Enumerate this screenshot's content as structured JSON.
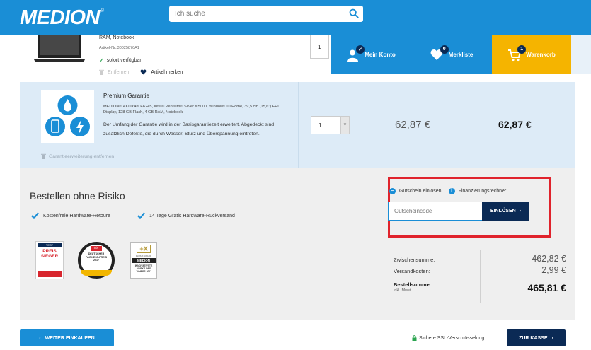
{
  "header": {
    "logo_text": "MEDION",
    "logo_reg": "®",
    "search_placeholder": "Ich suche"
  },
  "account": {
    "mein_konto": "Mein Konto",
    "merkliste": "Merkliste",
    "merkliste_count": "0",
    "warenkorb": "Warenkorb",
    "warenkorb_count": "1"
  },
  "product": {
    "subtitle": "RAM, Notebook",
    "article_no": "Artikel-Nr.:30025870A1",
    "availability": "sofort verfügbar",
    "remove_label": "Entfernen",
    "save_label": "Artikel merken",
    "quantity": "1"
  },
  "guarantee": {
    "title": "Premium Garantie",
    "description": "MEDION® AKOYA® E6245, Intel® Pentium® Silver N5000, Windows 10 Home, 39,5 cm (15,6\") FHD Display, 128 GB Flash, 4 GB RAM, Notebook",
    "details": "Der Umfang der Garantie wird in der Basisgarantiezeit erweitert. Abgedeckt sind zusätzlich Defekte, die durch Wasser, Sturz und Überspannung eintreten.",
    "remove_label": "Garantieerweiterung entfernen",
    "quantity": "1",
    "price": "62,87  €",
    "total": "62,87  €"
  },
  "risk": {
    "title": "Bestellen ohne Risiko",
    "feature1": "Kostenfreie Hardware-Retoure",
    "feature2": "14 Tage Gratis Hardware-Rückversand",
    "seal1_text": "PREIS SIEGER",
    "seal1_top": "TEST",
    "seal2_text": "DEUTSCHER FAIRNESS-PREIS 2017",
    "seal2_top": "ntv",
    "seal3_brand": "MEDION",
    "seal3_text": "INNOVATIVSTE MARKE DES JAHRES 2017",
    "seal3_top": "PLUS X AWARD"
  },
  "voucher": {
    "option1": "Gutschein einlösen",
    "option2": "Finanzierungsrechner",
    "placeholder": "Gutscheincode",
    "button": "EINLÖSEN",
    "colors": {
      "highlight": "#e0232c",
      "navy": "#0b2a55"
    }
  },
  "summary": {
    "zwischensumme_label": "Zwischensumme:",
    "zwischensumme_value": "462,82  €",
    "versand_label": "Versandkosten:",
    "versand_value": "2,99  €",
    "total_label": "Bestellsumme",
    "total_sub": "inkl. Mwst.",
    "total_value": "465,81  €"
  },
  "footer": {
    "weiter": "WEITER EINKAUFEN",
    "ssl": "Sichere SSL-Verschlüsselung",
    "kasse": "ZUR KASSE"
  },
  "colors": {
    "brand": "#1a8ed6",
    "cart": "#f5b400",
    "guarantee_bg": "#ddebf7",
    "section_bg": "#efefef"
  }
}
